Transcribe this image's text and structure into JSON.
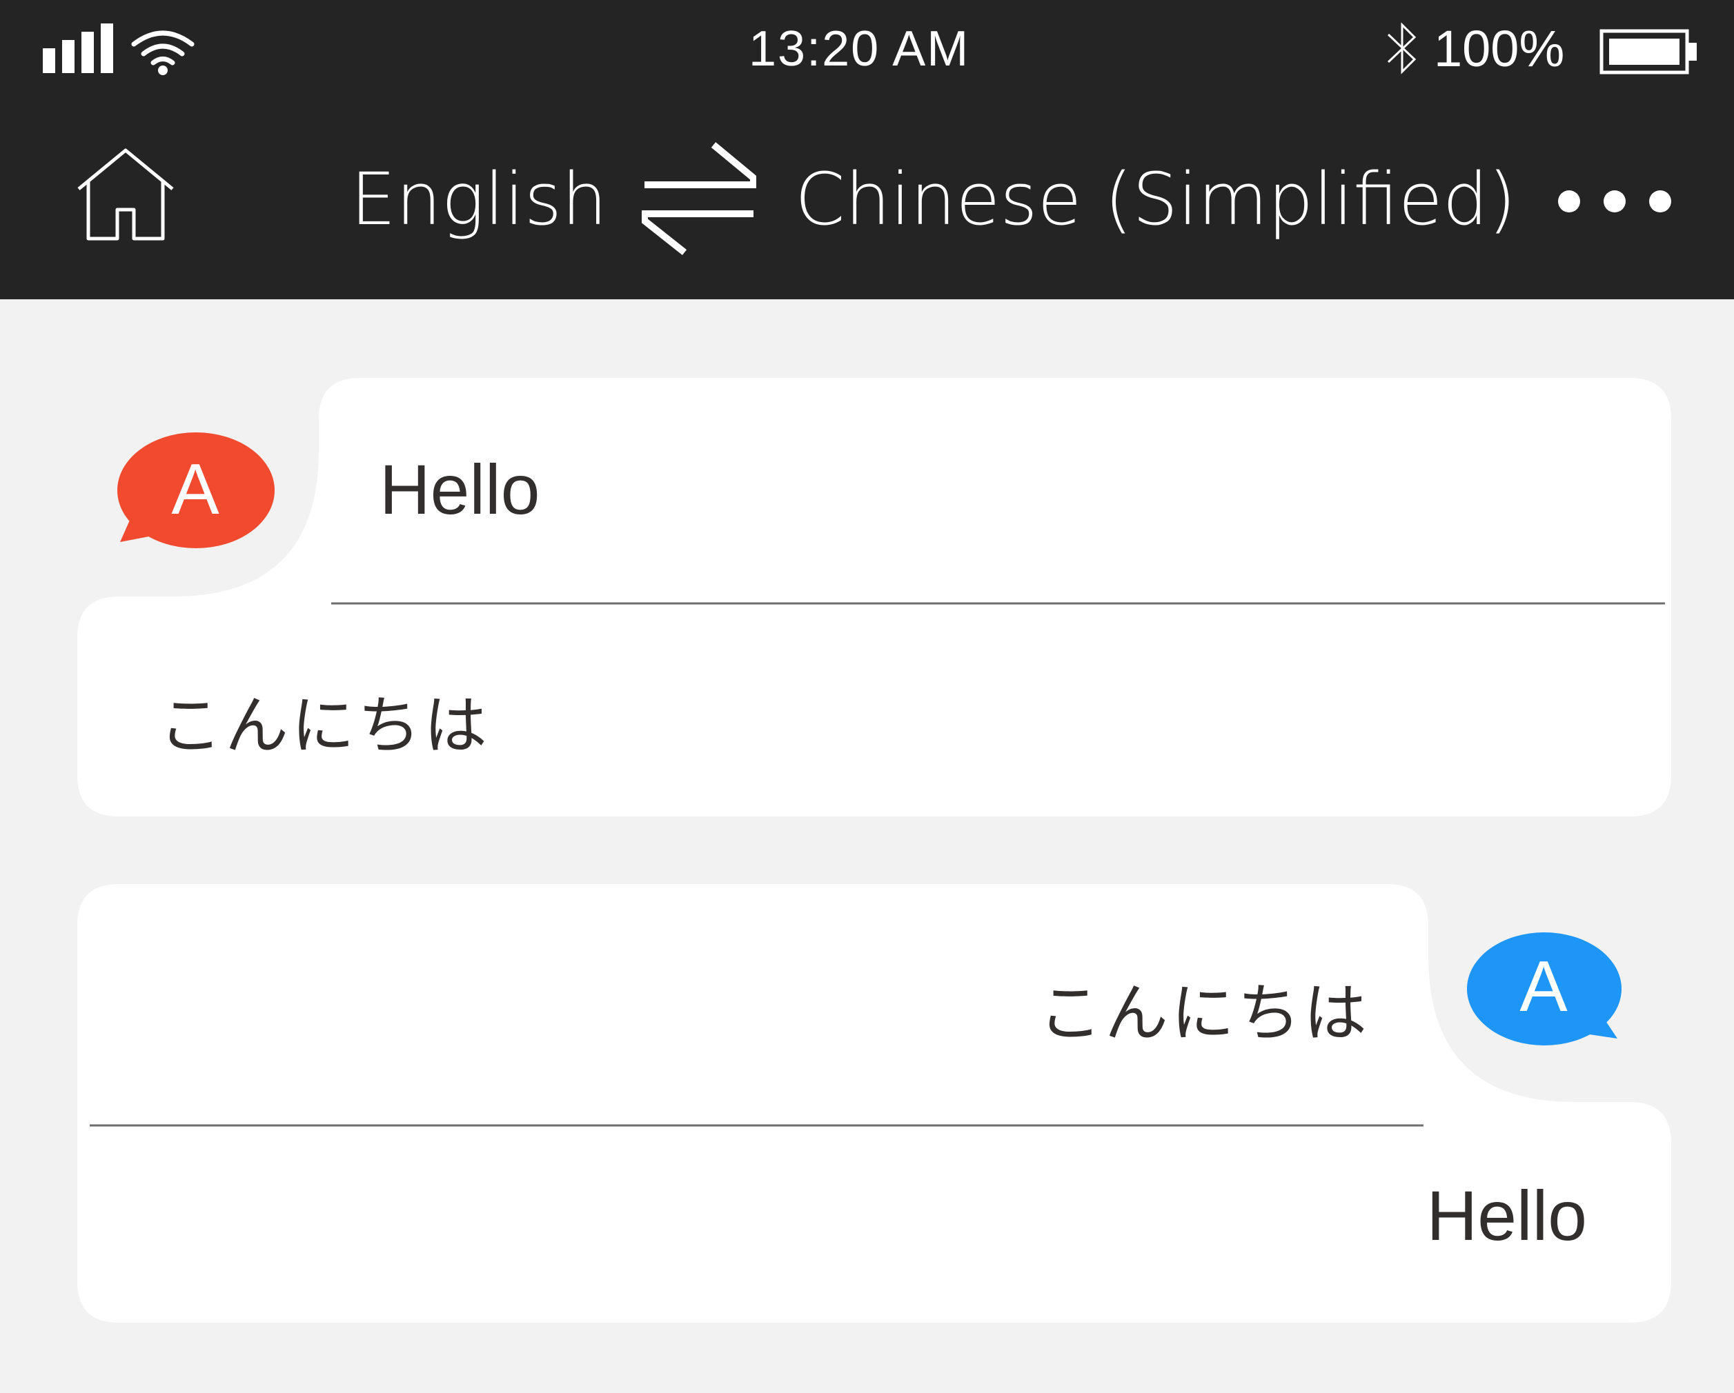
{
  "status_bar": {
    "time": "13:20 AM",
    "battery_percent": "100%",
    "battery_level": 1.0,
    "icons": [
      "signal-icon",
      "wifi-icon",
      "bluetooth-icon",
      "battery-icon"
    ]
  },
  "header": {
    "source_language": "English",
    "target_language": "Chinese (Simplified)",
    "icons": [
      "home-icon",
      "swap-icon",
      "more-icon"
    ]
  },
  "messages": [
    {
      "speaker": "A",
      "side": "left",
      "avatar_color": "#f24a2f",
      "source_text": "Hello",
      "translated_text": "こんにちは"
    },
    {
      "speaker": "A",
      "side": "right",
      "avatar_color": "#1e96f8",
      "source_text": "こんにちは",
      "translated_text": "Hello"
    }
  ],
  "colors": {
    "header_bg": "#242424",
    "page_bg": "#f2f2f2",
    "bubble_bg": "#ffffff",
    "text": "#332e2e"
  }
}
